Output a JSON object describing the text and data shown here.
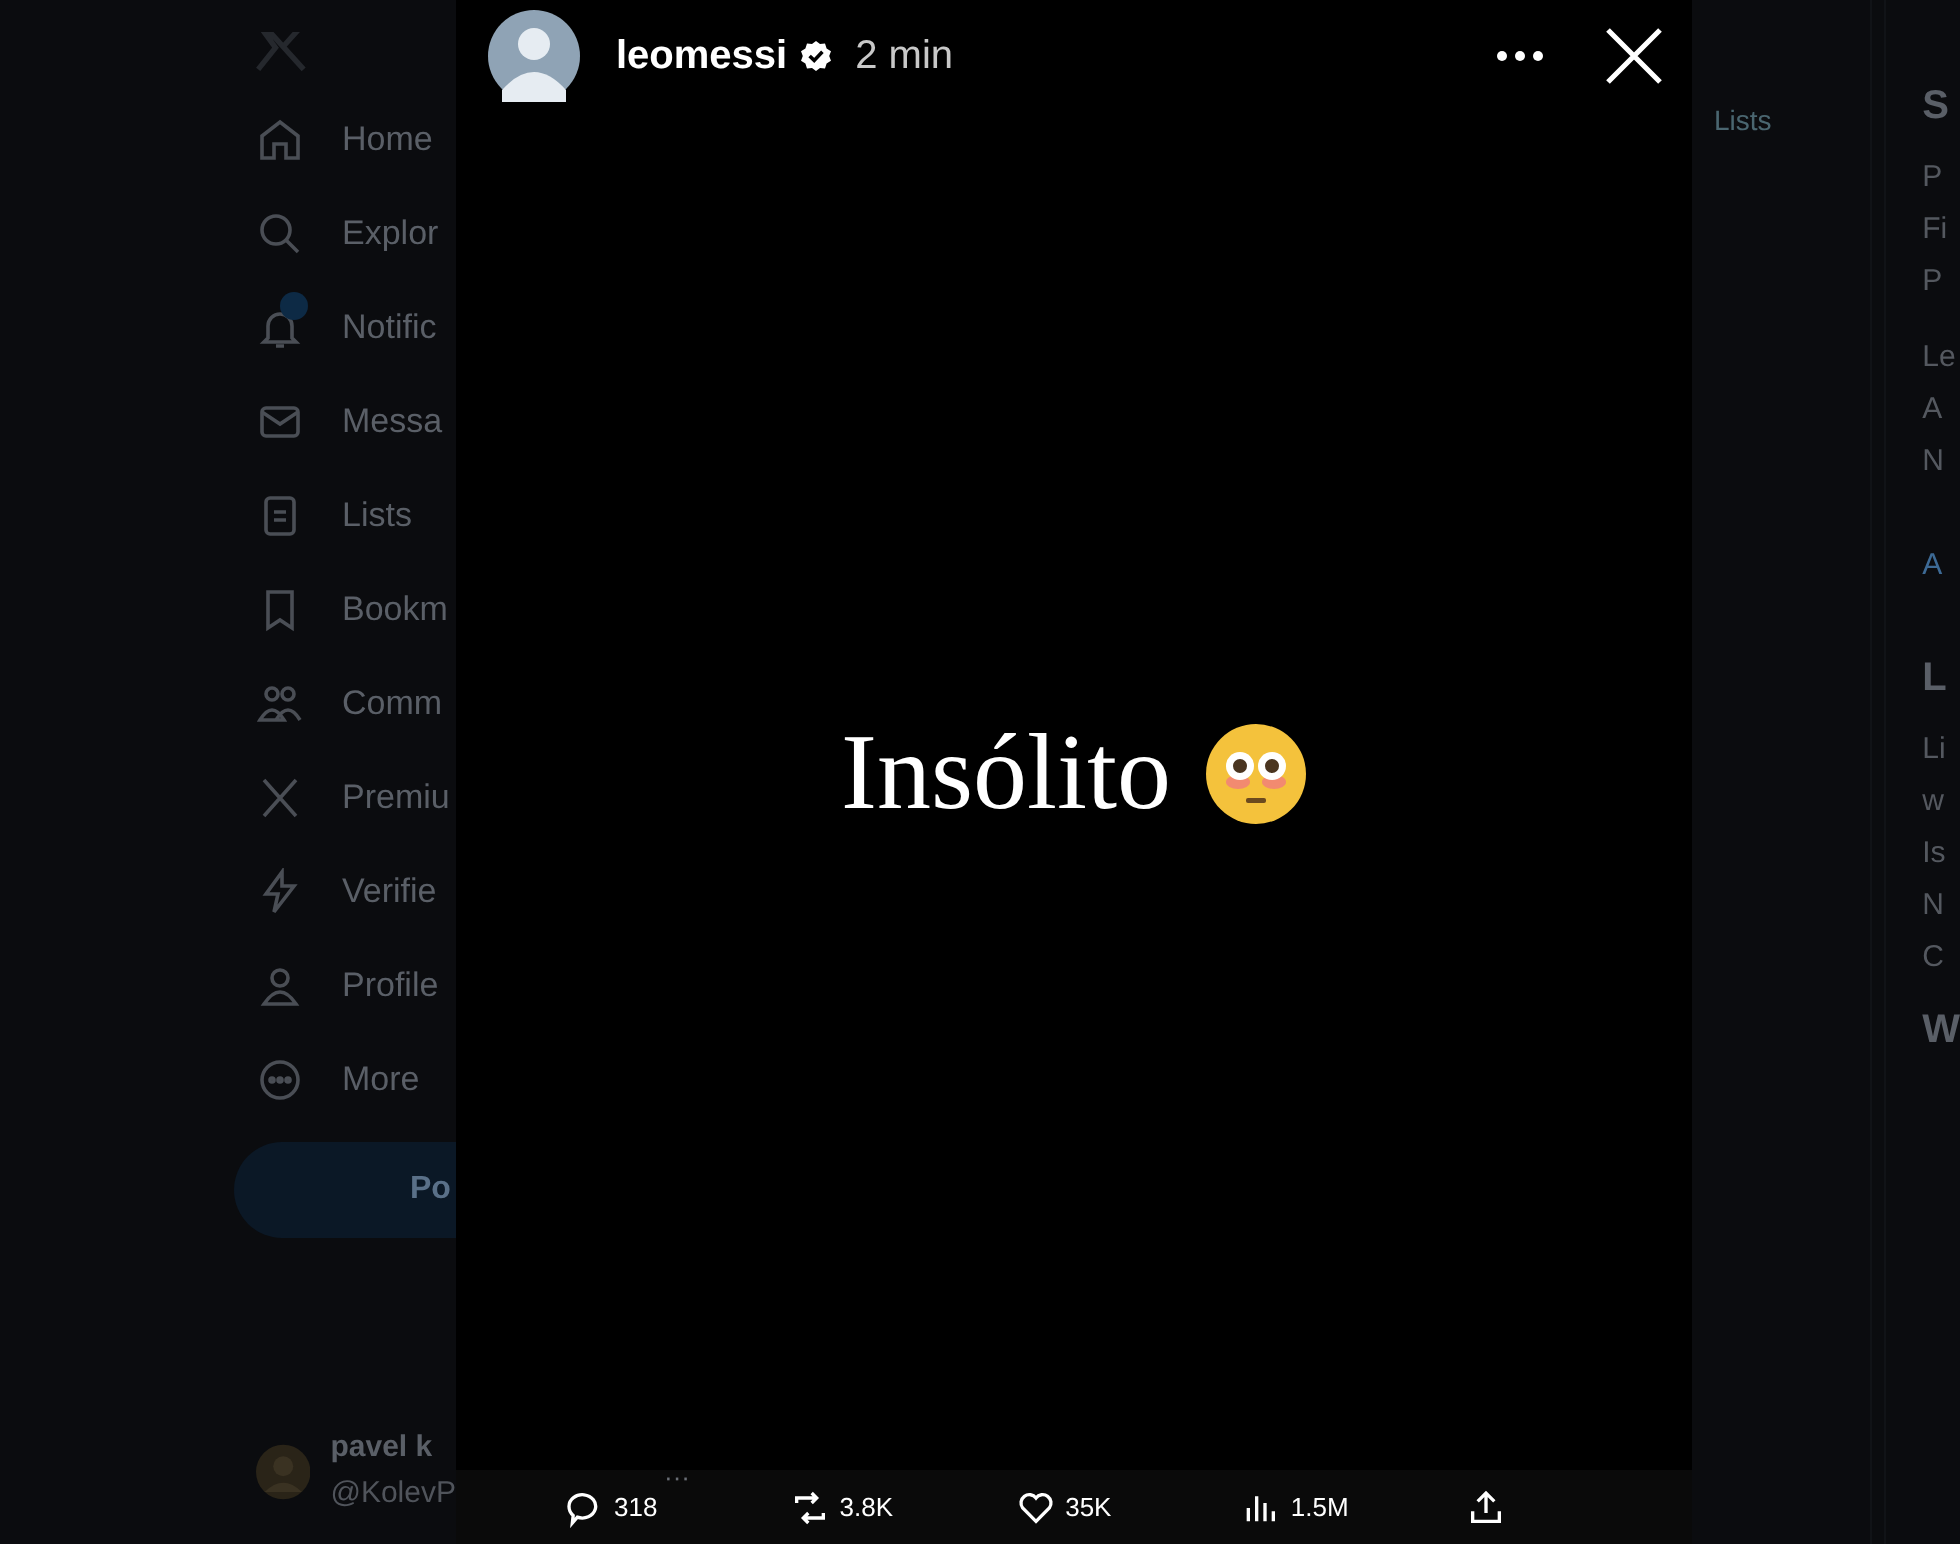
{
  "sidebar": {
    "items": [
      {
        "kind": "home",
        "label": "Home",
        "badge": false
      },
      {
        "kind": "explore",
        "label": "Explor",
        "badge": false
      },
      {
        "kind": "notifications",
        "label": "Notific",
        "badge": true
      },
      {
        "kind": "messages",
        "label": "Messa",
        "badge": false
      },
      {
        "kind": "lists",
        "label": "Lists",
        "badge": false
      },
      {
        "kind": "bookmarks",
        "label": "Bookm",
        "badge": false
      },
      {
        "kind": "communities",
        "label": "Comm",
        "badge": false
      },
      {
        "kind": "premium",
        "label": "Premiu",
        "badge": false
      },
      {
        "kind": "verified",
        "label": "Verifie",
        "badge": false
      },
      {
        "kind": "profile",
        "label": "Profile",
        "badge": false
      },
      {
        "kind": "more",
        "label": "More",
        "badge": false
      }
    ],
    "post_button": "Po"
  },
  "account": {
    "name": "pavel k",
    "handle": "@KolevP",
    "more": "···"
  },
  "timeline": {
    "tab": "Lists"
  },
  "right_column": {
    "texts": [
      {
        "kind": "heading",
        "text": "S"
      },
      {
        "kind": "text",
        "text": "P"
      },
      {
        "kind": "text",
        "text": "Fi"
      },
      {
        "kind": "text",
        "text": "P"
      },
      {
        "kind": "gap",
        "text": "Le"
      },
      {
        "kind": "text",
        "text": "A"
      },
      {
        "kind": "text",
        "text": "N"
      },
      {
        "kind": "link",
        "text": "A"
      },
      {
        "kind": "heading",
        "text": "L"
      },
      {
        "kind": "text",
        "text": "Li"
      },
      {
        "kind": "text",
        "text": "w"
      },
      {
        "kind": "text",
        "text": "Is"
      },
      {
        "kind": "text",
        "text": "N"
      },
      {
        "kind": "text",
        "text": "C"
      },
      {
        "kind": "heading",
        "text": "W"
      }
    ]
  },
  "story": {
    "username": "leomessi",
    "verified": true,
    "time": "2 min",
    "caption": "Insólito"
  },
  "actions": [
    {
      "kind": "reply",
      "count": "318"
    },
    {
      "kind": "repost",
      "count": "3.8K"
    },
    {
      "kind": "like",
      "count": "35K"
    },
    {
      "kind": "views",
      "count": "1.5M"
    },
    {
      "kind": "share"
    }
  ]
}
